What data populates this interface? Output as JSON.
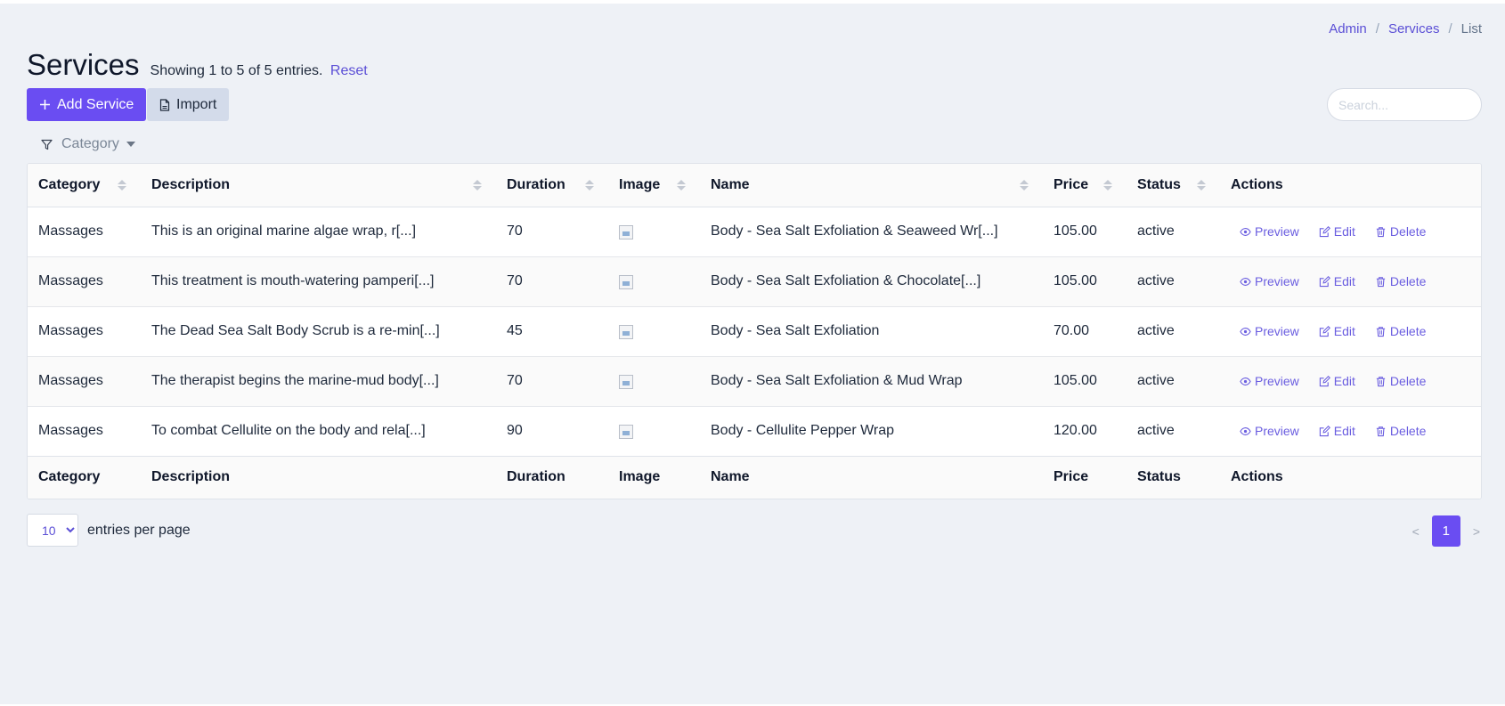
{
  "breadcrumb": [
    {
      "label": "Admin"
    },
    {
      "label": "Services"
    },
    {
      "label": "List"
    }
  ],
  "breadcrumb_separator": "/",
  "header": {
    "title": "Services",
    "entries_info": "Showing 1 to 5 of 5 entries.",
    "reset_label": "Reset"
  },
  "toolbar": {
    "add_label": "Add Service",
    "import_label": "Import",
    "search_placeholder": "Search..."
  },
  "filter": {
    "label": "Category"
  },
  "table": {
    "columns": [
      "Category",
      "Description",
      "Duration",
      "Image",
      "Name",
      "Price",
      "Status",
      "Actions"
    ],
    "rows": [
      {
        "category": "Massages",
        "description": "This is an original marine algae wrap, r[...]",
        "duration": "70",
        "name": "Body - Sea Salt Exfoliation & Seaweed Wr[...]",
        "price": "105.00",
        "status": "active"
      },
      {
        "category": "Massages",
        "description": "This treatment is mouth-watering pamperi[...]",
        "duration": "70",
        "name": "Body - Sea Salt Exfoliation & Chocolate[...]",
        "price": "105.00",
        "status": "active"
      },
      {
        "category": "Massages",
        "description": "The Dead Sea Salt Body Scrub is a re-min[...]",
        "duration": "45",
        "name": "Body - Sea Salt Exfoliation",
        "price": "70.00",
        "status": "active"
      },
      {
        "category": "Massages",
        "description": "The therapist begins the marine-mud body[...]",
        "duration": "70",
        "name": "Body - Sea Salt Exfoliation & Mud Wrap",
        "price": "105.00",
        "status": "active"
      },
      {
        "category": "Massages",
        "description": "To combat Cellulite on the body and rela[...]",
        "duration": "90",
        "name": "Body - Cellulite Pepper Wrap",
        "price": "120.00",
        "status": "active"
      }
    ],
    "actions": {
      "preview": "Preview",
      "edit": "Edit",
      "delete": "Delete"
    }
  },
  "footer": {
    "per_page_value": "10",
    "per_page_label": "entries per page",
    "prev": "<",
    "current_page": "1",
    "next": ">"
  },
  "colors": {
    "accent": "#6a4df2",
    "link": "#5b4fd6",
    "background": "#eef1f6"
  }
}
